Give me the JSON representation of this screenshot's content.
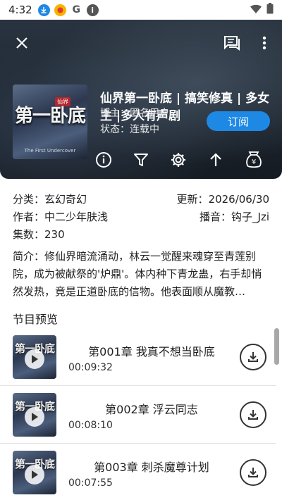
{
  "status_bar": {
    "time": "4:32",
    "left_icons": [
      "download-icon",
      "app-icon",
      "google-icon",
      "info-icon"
    ],
    "right_icons": [
      "wifi-icon",
      "battery-icon"
    ]
  },
  "header": {
    "close_icon": "close-icon",
    "comment_icon": "comment-icon",
    "more_icon": "more-vert-icon",
    "cover_title": "第一卧底",
    "cover_badge": "仙界",
    "cover_subtitle": "The First Undercover",
    "title": "仙界第一卧底 | 搞笑修真 | 多女主 |多人有声剧",
    "blogger": "博主：匿名用户",
    "state": "状态：连载中",
    "subscribe_label": "订阅",
    "toolbar_icons": [
      "info-icon",
      "filter-icon",
      "settings-icon",
      "arrow-up-icon",
      "money-bag-icon"
    ]
  },
  "info": {
    "category": "分类：玄幻奇幻",
    "updated": "更新：2026/06/30",
    "author": "作者：中二少年肤浅",
    "narrator": "播音：钩子_Jzi",
    "episodes": "集数：230",
    "summary": "简介：修仙界暗流涌动，林云一觉醒来魂穿至青莲别院，成为被献祭的'炉鼎'。体内种下青龙蛊，右手却悄然发热，竟是正道卧底的信物。他表面顺从魔教…"
  },
  "preview": {
    "section_title": "节目预览",
    "episodes": [
      {
        "title": "第001章 我真不想当卧底",
        "duration": "00:09:32"
      },
      {
        "title": "第002章 浮云同志",
        "duration": "00:08:10"
      },
      {
        "title": "第003章 刺杀魔尊计划",
        "duration": "00:07:55"
      }
    ],
    "thumb_title": "第一卧底"
  },
  "colors": {
    "accent": "#1e88e5",
    "header_bg": "#1e2732"
  }
}
